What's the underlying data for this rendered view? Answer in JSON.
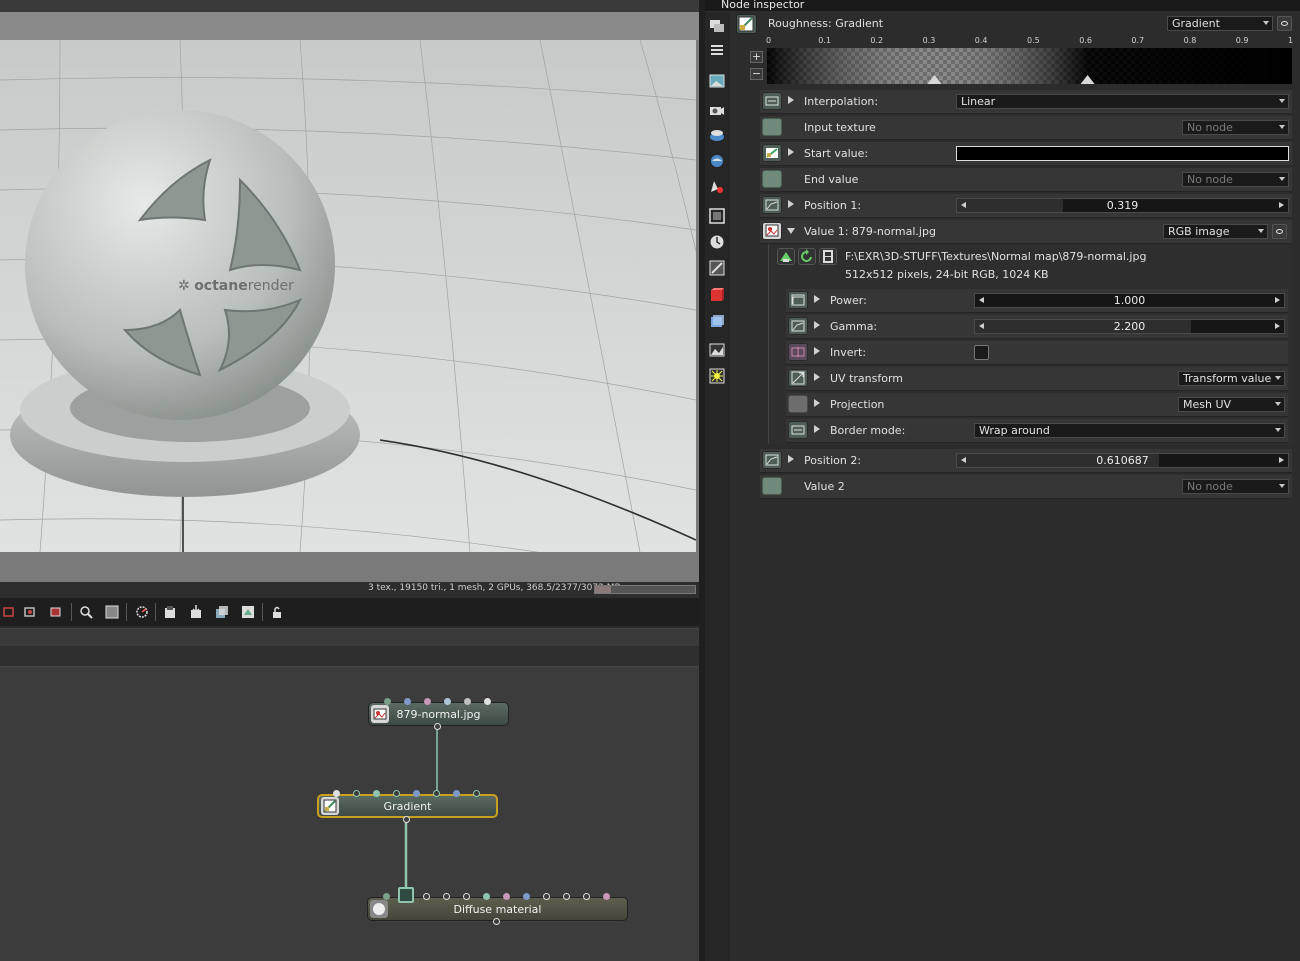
{
  "status": {
    "text": "3 tex., 19150 tri., 1 mesh, 2 GPUs, 368.5/2377/3072 MB",
    "vram_used_fraction": 0.155
  },
  "render": {
    "logo_text": "octanerender",
    "logo_bold": "octane",
    "logo_light": "render"
  },
  "graph": {
    "nodes": [
      {
        "title": "879-normal.jpg",
        "icon": "image-texture-icon"
      },
      {
        "title": "Gradient",
        "icon": "gradient-icon"
      },
      {
        "title": "Diffuse material",
        "icon": "material-sphere-icon"
      }
    ]
  },
  "inspector": {
    "title": "Node inspector",
    "node_name": "Roughness: Gradient",
    "node_type": "Gradient",
    "ruler_ticks": [
      "0",
      "0.1",
      "0.2",
      "0.3",
      "0.4",
      "0.5",
      "0.6",
      "0.7",
      "0.8",
      "0.9",
      "1"
    ],
    "add_label": "+",
    "remove_label": "−",
    "interpolation": {
      "label": "Interpolation:",
      "value": "Linear"
    },
    "input_texture": {
      "label": "Input texture",
      "value": "No node"
    },
    "start_value": {
      "label": "Start value:",
      "color": "#000000"
    },
    "end_value": {
      "label": "End value",
      "value": "No node"
    },
    "position1": {
      "label": "Position 1:",
      "value": "0.319",
      "fraction": 0.319
    },
    "value1": {
      "label": "Value 1: 879-normal.jpg",
      "type": "RGB image",
      "file_path": "F:\\EXR\\3D-STUFF\\Textures\\Normal map\\879-normal.jpg",
      "file_info": "512x512 pixels, 24-bit RGB, 1024 KB",
      "power": {
        "label": "Power:",
        "value": "1.000",
        "fraction": 0.0
      },
      "gamma": {
        "label": "Gamma:",
        "value": "2.200",
        "fraction": 0.7
      },
      "invert": {
        "label": "Invert:",
        "checked": false
      },
      "uv_transform": {
        "label": "UV transform",
        "value": "Transform value"
      },
      "projection": {
        "label": "Projection",
        "value": "Mesh UV"
      },
      "border_mode": {
        "label": "Border mode:",
        "value": "Wrap around"
      }
    },
    "position2": {
      "label": "Position 2:",
      "value": "0.610687",
      "fraction": 0.610687
    },
    "value2": {
      "label": "Value 2",
      "value": "No node"
    }
  },
  "colors": {
    "node_selected_border": "#c8a020",
    "pin_green": "#7aa08a",
    "pin_blue": "#7f9ac8",
    "pin_pink": "#c898b8",
    "link": "#8fc4ae"
  }
}
